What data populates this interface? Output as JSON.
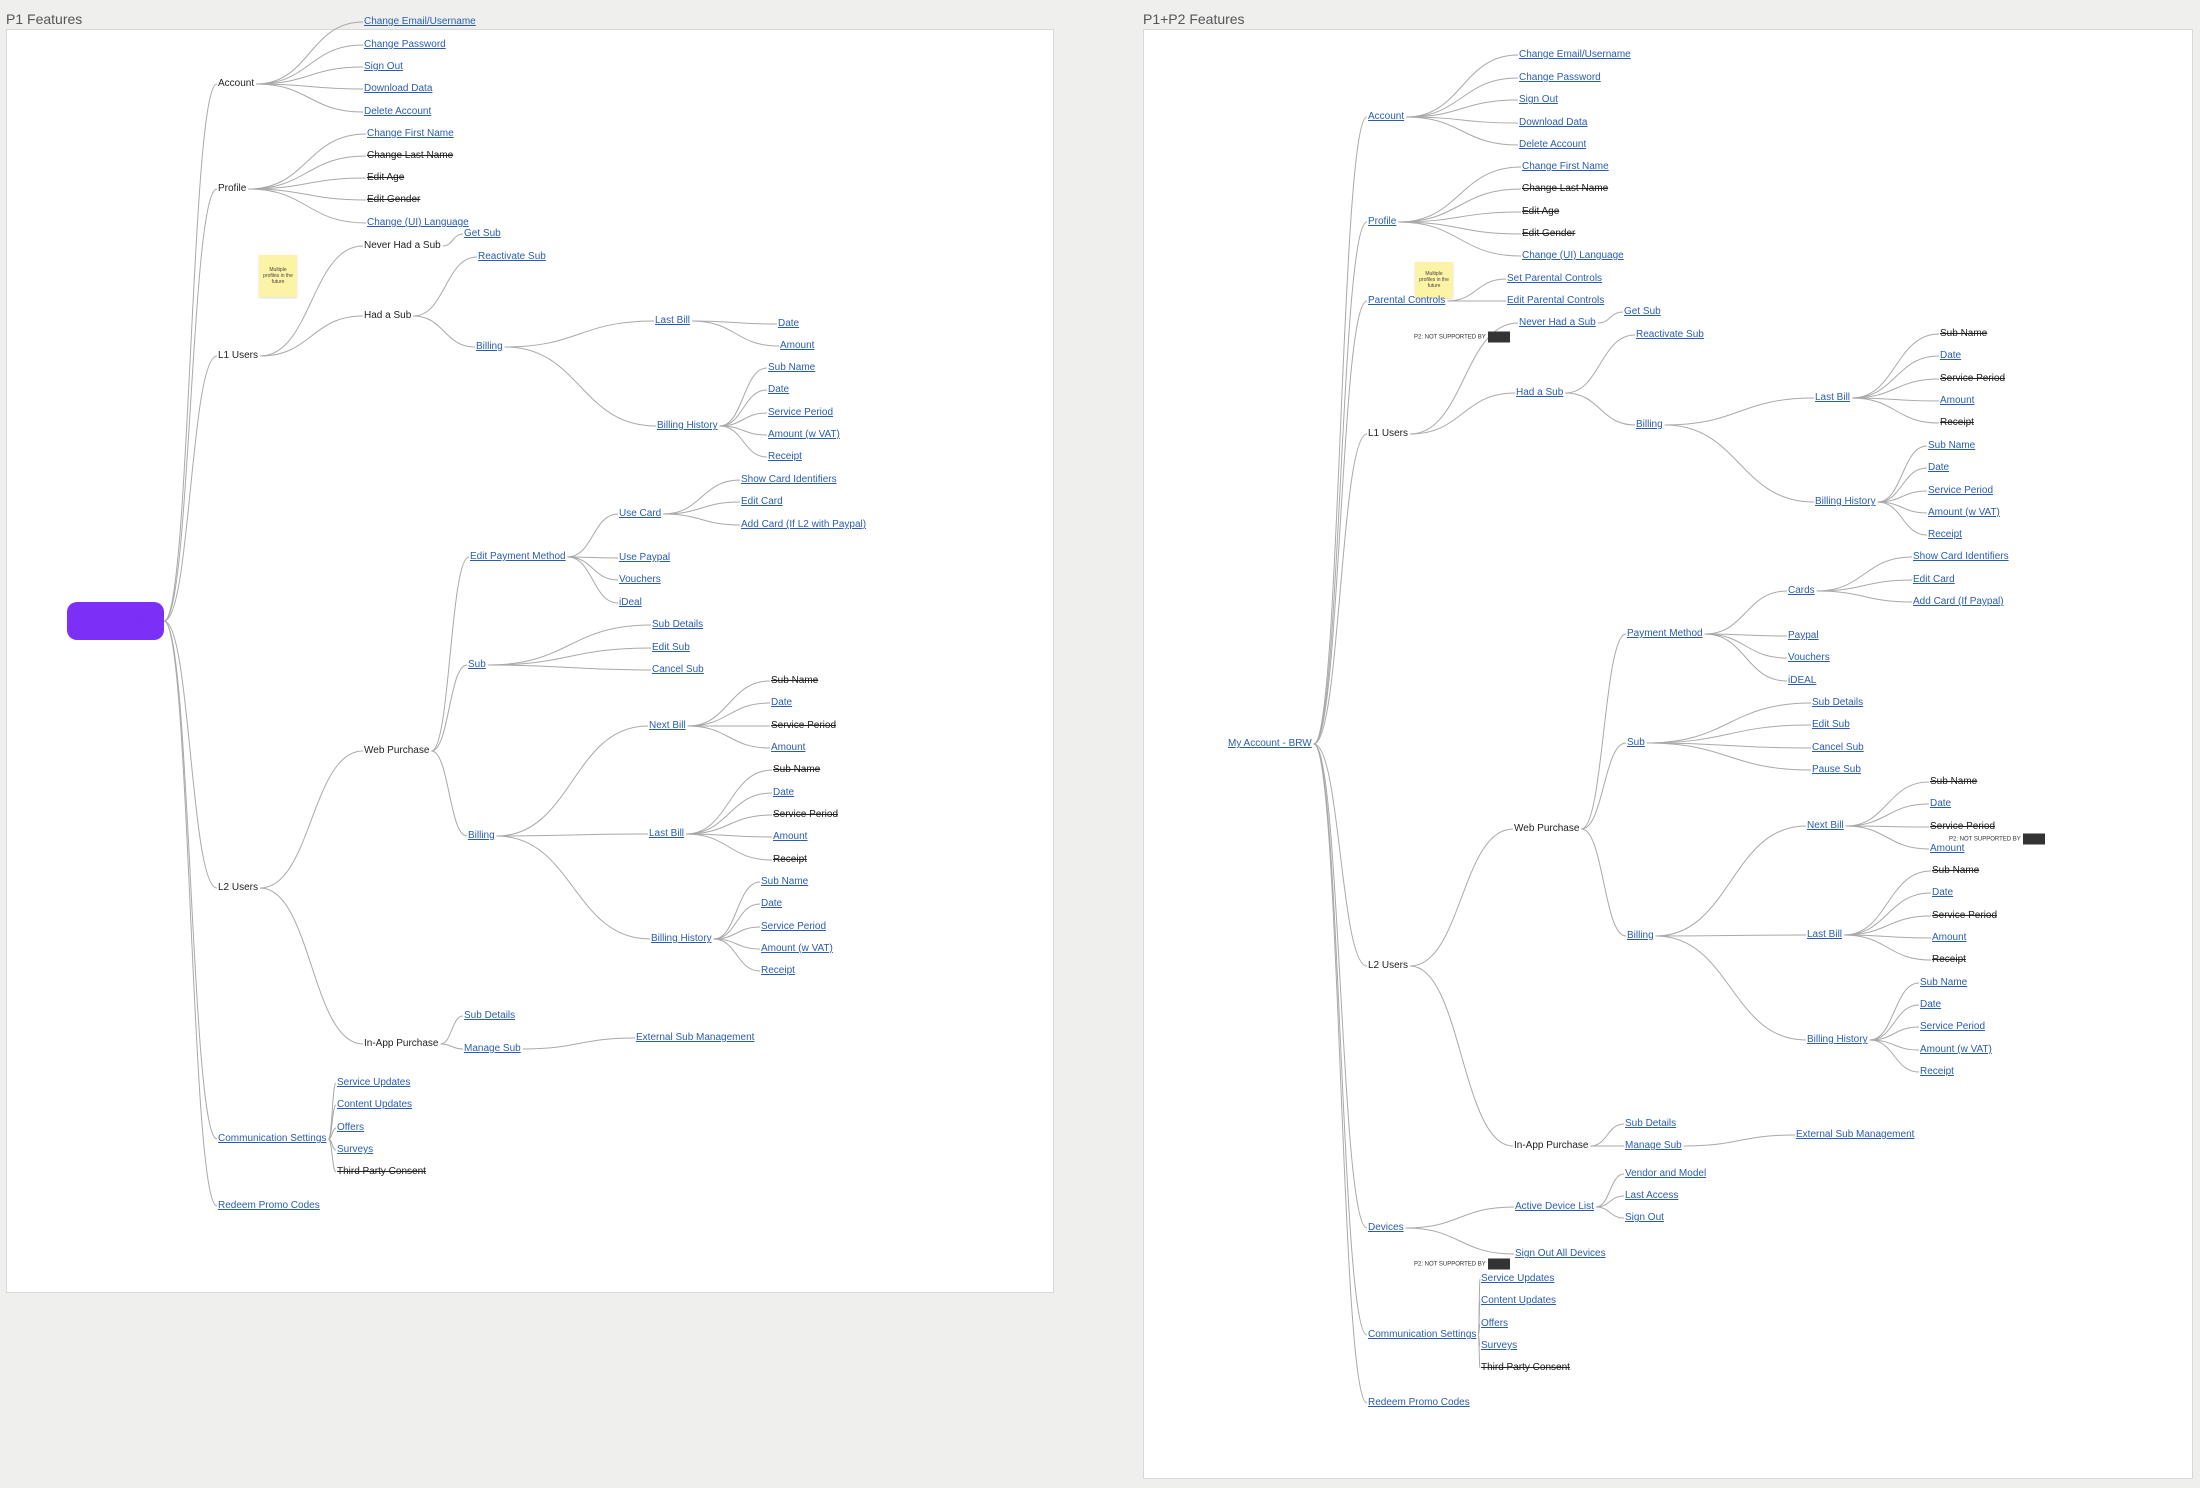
{
  "frames": [
    {
      "title": "P1 Features"
    },
    {
      "title": "P1+P2 Features"
    }
  ],
  "colors": {
    "link": "#2a5db0",
    "edge": "#a9a9a9",
    "root_pill": "#7b2ff7",
    "sticky": "#fdf3a6"
  },
  "root_label": "My Account - BRW",
  "sticky_text": "Multiple profiles in the future",
  "tag_text": "P2: NOT SUPPORTED BY",
  "p1_nodes": [
    {
      "label": "Account",
      "s": "plain"
    },
    {
      "label": "Change Email/Username",
      "s": "link"
    },
    {
      "label": "Change Password",
      "s": "link"
    },
    {
      "label": "Sign Out",
      "s": "link"
    },
    {
      "label": "Download Data",
      "s": "link"
    },
    {
      "label": "Delete Account",
      "s": "link"
    },
    {
      "label": "Profile",
      "s": "plain"
    },
    {
      "label": "Change First Name",
      "s": "link"
    },
    {
      "label": "Change Last Name",
      "s": "struck"
    },
    {
      "label": "Edit Age",
      "s": "struck"
    },
    {
      "label": "Edit Gender",
      "s": "struck"
    },
    {
      "label": "Change (UI) Language",
      "s": "link"
    },
    {
      "label": "L1 Users",
      "s": "plain"
    },
    {
      "label": "Never Had a Sub",
      "s": "plain"
    },
    {
      "label": "Get Sub",
      "s": "link"
    },
    {
      "label": "Had a Sub",
      "s": "plain"
    },
    {
      "label": "Reactivate Sub",
      "s": "link"
    },
    {
      "label": "Billing",
      "s": "link"
    },
    {
      "label": "Last Bill",
      "s": "link"
    },
    {
      "label": "Date",
      "s": "link"
    },
    {
      "label": "Amount",
      "s": "link"
    },
    {
      "label": "Billing History",
      "s": "link"
    },
    {
      "label": "Sub Name",
      "s": "link"
    },
    {
      "label": "Date",
      "s": "link"
    },
    {
      "label": "Service Period",
      "s": "link"
    },
    {
      "label": "Amount (w VAT)",
      "s": "link"
    },
    {
      "label": "Receipt",
      "s": "link"
    },
    {
      "label": "L2 Users",
      "s": "plain"
    },
    {
      "label": "Web Purchase",
      "s": "plain"
    },
    {
      "label": "Edit Payment Method",
      "s": "link"
    },
    {
      "label": "Use Card",
      "s": "link"
    },
    {
      "label": "Show Card Identifiers",
      "s": "link"
    },
    {
      "label": "Edit Card",
      "s": "link"
    },
    {
      "label": "Add Card (If L2 with Paypal)",
      "s": "link"
    },
    {
      "label": "Use Paypal",
      "s": "link"
    },
    {
      "label": "Vouchers",
      "s": "link"
    },
    {
      "label": "iDeal",
      "s": "link"
    },
    {
      "label": "Sub",
      "s": "link"
    },
    {
      "label": "Sub Details",
      "s": "link"
    },
    {
      "label": "Edit Sub",
      "s": "link"
    },
    {
      "label": "Cancel Sub",
      "s": "link"
    },
    {
      "label": "Billing",
      "s": "link"
    },
    {
      "label": "Next Bill",
      "s": "link"
    },
    {
      "label": "Sub Name",
      "s": "struck"
    },
    {
      "label": "Date",
      "s": "link"
    },
    {
      "label": "Service Period",
      "s": "struck"
    },
    {
      "label": "Amount",
      "s": "link"
    },
    {
      "label": "Last Bill",
      "s": "link"
    },
    {
      "label": "Sub Name",
      "s": "struck"
    },
    {
      "label": "Date",
      "s": "link"
    },
    {
      "label": "Service Period",
      "s": "struck"
    },
    {
      "label": "Amount",
      "s": "link"
    },
    {
      "label": "Receipt",
      "s": "struck"
    },
    {
      "label": "Billing History",
      "s": "link"
    },
    {
      "label": "Sub Name",
      "s": "link"
    },
    {
      "label": "Date",
      "s": "link"
    },
    {
      "label": "Service Period",
      "s": "link"
    },
    {
      "label": "Amount (w VAT)",
      "s": "link"
    },
    {
      "label": "Receipt",
      "s": "link"
    },
    {
      "label": "In-App Purchase",
      "s": "plain"
    },
    {
      "label": "Sub Details",
      "s": "link"
    },
    {
      "label": "Manage Sub",
      "s": "link"
    },
    {
      "label": "External Sub Management",
      "s": "link"
    },
    {
      "label": "Communication Settings",
      "s": "link"
    },
    {
      "label": "Service Updates",
      "s": "link"
    },
    {
      "label": "Content Updates",
      "s": "link"
    },
    {
      "label": "Offers",
      "s": "link"
    },
    {
      "label": "Surveys",
      "s": "link"
    },
    {
      "label": "Third Party Consent",
      "s": "struck"
    },
    {
      "label": "Redeem Promo Codes",
      "s": "link"
    }
  ],
  "p2_nodes": [
    {
      "label": "My Account - BRW",
      "s": "link"
    },
    {
      "label": "Account",
      "s": "link"
    },
    {
      "label": "Change Email/Username",
      "s": "link"
    },
    {
      "label": "Change Password",
      "s": "link"
    },
    {
      "label": "Sign Out",
      "s": "link"
    },
    {
      "label": "Download Data",
      "s": "link"
    },
    {
      "label": "Delete Account",
      "s": "link"
    },
    {
      "label": "Profile",
      "s": "link"
    },
    {
      "label": "Change First Name",
      "s": "link"
    },
    {
      "label": "Change Last Name",
      "s": "struck"
    },
    {
      "label": "Edit Age",
      "s": "struck"
    },
    {
      "label": "Edit Gender",
      "s": "struck"
    },
    {
      "label": "Change (UI) Language",
      "s": "link"
    },
    {
      "label": "Parental Controls",
      "s": "link"
    },
    {
      "label": "Set Parental Controls",
      "s": "link"
    },
    {
      "label": "Edit Parental Controls",
      "s": "link"
    },
    {
      "label": "L1 Users",
      "s": "plain"
    },
    {
      "label": "Never Had a Sub",
      "s": "link"
    },
    {
      "label": "Get Sub",
      "s": "link"
    },
    {
      "label": "Had a Sub",
      "s": "link"
    },
    {
      "label": "Reactivate Sub",
      "s": "link"
    },
    {
      "label": "Billing",
      "s": "link"
    },
    {
      "label": "Last Bill",
      "s": "link"
    },
    {
      "label": "Sub Name",
      "s": "struck"
    },
    {
      "label": "Date",
      "s": "link"
    },
    {
      "label": "Service Period",
      "s": "struck"
    },
    {
      "label": "Amount",
      "s": "link"
    },
    {
      "label": "Receipt",
      "s": "struck"
    },
    {
      "label": "Billing History",
      "s": "link"
    },
    {
      "label": "Sub Name",
      "s": "link"
    },
    {
      "label": "Date",
      "s": "link"
    },
    {
      "label": "Service Period",
      "s": "link"
    },
    {
      "label": "Amount (w VAT)",
      "s": "link"
    },
    {
      "label": "Receipt",
      "s": "link"
    },
    {
      "label": "L2 Users",
      "s": "plain"
    },
    {
      "label": "Web Purchase",
      "s": "plain"
    },
    {
      "label": "Payment Method",
      "s": "link"
    },
    {
      "label": "Cards",
      "s": "link"
    },
    {
      "label": "Show Card Identifiers",
      "s": "link"
    },
    {
      "label": "Edit Card",
      "s": "link"
    },
    {
      "label": "Add Card (If Paypal)",
      "s": "link"
    },
    {
      "label": "Paypal",
      "s": "link"
    },
    {
      "label": "Vouchers",
      "s": "link"
    },
    {
      "label": "iDEAL",
      "s": "link"
    },
    {
      "label": "Sub",
      "s": "link"
    },
    {
      "label": "Sub Details",
      "s": "link"
    },
    {
      "label": "Edit Sub",
      "s": "link"
    },
    {
      "label": "Cancel Sub",
      "s": "link"
    },
    {
      "label": "Pause Sub",
      "s": "link"
    },
    {
      "label": "Billing",
      "s": "link"
    },
    {
      "label": "Next Bill",
      "s": "link"
    },
    {
      "label": "Sub Name",
      "s": "struck"
    },
    {
      "label": "Date",
      "s": "link"
    },
    {
      "label": "Service Period",
      "s": "struck"
    },
    {
      "label": "Amount",
      "s": "link"
    },
    {
      "label": "Last Bill",
      "s": "link"
    },
    {
      "label": "Sub Name",
      "s": "struck"
    },
    {
      "label": "Date",
      "s": "link"
    },
    {
      "label": "Service Period",
      "s": "struck"
    },
    {
      "label": "Amount",
      "s": "link"
    },
    {
      "label": "Receipt",
      "s": "struck"
    },
    {
      "label": "Billing History",
      "s": "link"
    },
    {
      "label": "Sub Name",
      "s": "link"
    },
    {
      "label": "Date",
      "s": "link"
    },
    {
      "label": "Service Period",
      "s": "link"
    },
    {
      "label": "Amount (w VAT)",
      "s": "link"
    },
    {
      "label": "Receipt",
      "s": "link"
    },
    {
      "label": "In-App Purchase",
      "s": "plain"
    },
    {
      "label": "Sub Details",
      "s": "link"
    },
    {
      "label": "Manage Sub",
      "s": "link"
    },
    {
      "label": "External Sub Management",
      "s": "link"
    },
    {
      "label": "Devices",
      "s": "link"
    },
    {
      "label": "Active Device List",
      "s": "link"
    },
    {
      "label": "Vendor and Model",
      "s": "link"
    },
    {
      "label": "Last Access",
      "s": "link"
    },
    {
      "label": "Sign Out",
      "s": "link"
    },
    {
      "label": "Sign Out All Devices",
      "s": "link"
    },
    {
      "label": "Communication Settings",
      "s": "link"
    },
    {
      "label": "Service Updates",
      "s": "link"
    },
    {
      "label": "Content Updates",
      "s": "link"
    },
    {
      "label": "Offers",
      "s": "link"
    },
    {
      "label": "Surveys",
      "s": "link"
    },
    {
      "label": "Third Party Consent",
      "s": "struck"
    },
    {
      "label": "Redeem Promo Codes",
      "s": "link"
    }
  ]
}
